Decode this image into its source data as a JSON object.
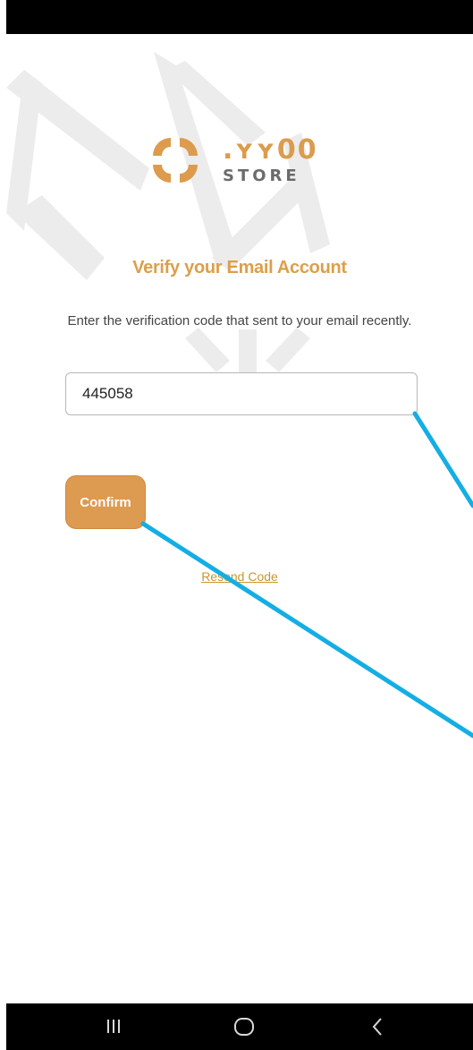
{
  "app": {
    "brand_name": ".ʏʏ00",
    "brand_sub": "STORE",
    "accent_color": "#dd9a51"
  },
  "verify": {
    "title": "Verify your Email Account",
    "instructions": "Enter the verification code that sent to your email recently.",
    "code_value": "445058",
    "confirm_label": "Confirm",
    "resend_label": "Resend Code"
  },
  "icons": {
    "logo_mark": "four-petal-logo-icon",
    "nav_recent": "recent-apps-icon",
    "nav_home": "home-icon",
    "nav_back": "back-chevron-icon"
  },
  "annotation": {
    "line_color": "#14aee4"
  }
}
